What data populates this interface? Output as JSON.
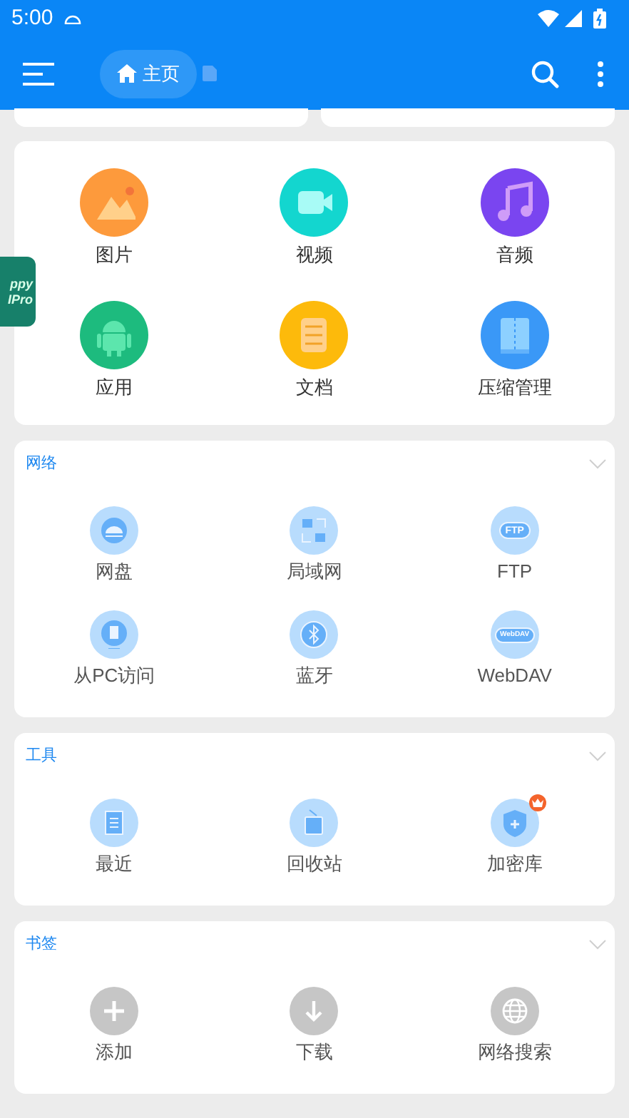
{
  "status_bar": {
    "time": "5:00"
  },
  "app_bar": {
    "breadcrumb": "主页"
  },
  "floating_badge": {
    "lines": [
      "ppy",
      "IPro"
    ]
  },
  "categories": [
    {
      "label": "图片",
      "color": "#fd9a3c"
    },
    {
      "label": "视频",
      "color": "#13d6cf"
    },
    {
      "label": "音频",
      "color": "#7a45f0"
    },
    {
      "label": "应用",
      "color": "#1dbb7e"
    },
    {
      "label": "文档",
      "color": "#fdba0b"
    },
    {
      "label": "压缩管理",
      "color": "#3a98f7"
    }
  ],
  "sections": [
    {
      "title": "网络",
      "items": [
        {
          "label": "网盘"
        },
        {
          "label": "局域网"
        },
        {
          "label": "FTP",
          "icon_text": "FTP"
        },
        {
          "label": "从PC访问"
        },
        {
          "label": "蓝牙"
        },
        {
          "label": "WebDAV",
          "icon_text": "WebDAV"
        }
      ]
    },
    {
      "title": "工具",
      "items": [
        {
          "label": "最近",
          "premium": false
        },
        {
          "label": "回收站",
          "premium": false
        },
        {
          "label": "加密库",
          "premium": true
        }
      ]
    },
    {
      "title": "书签",
      "items": [
        {
          "label": "添加"
        },
        {
          "label": "下载"
        },
        {
          "label": "网络搜索"
        }
      ]
    }
  ]
}
